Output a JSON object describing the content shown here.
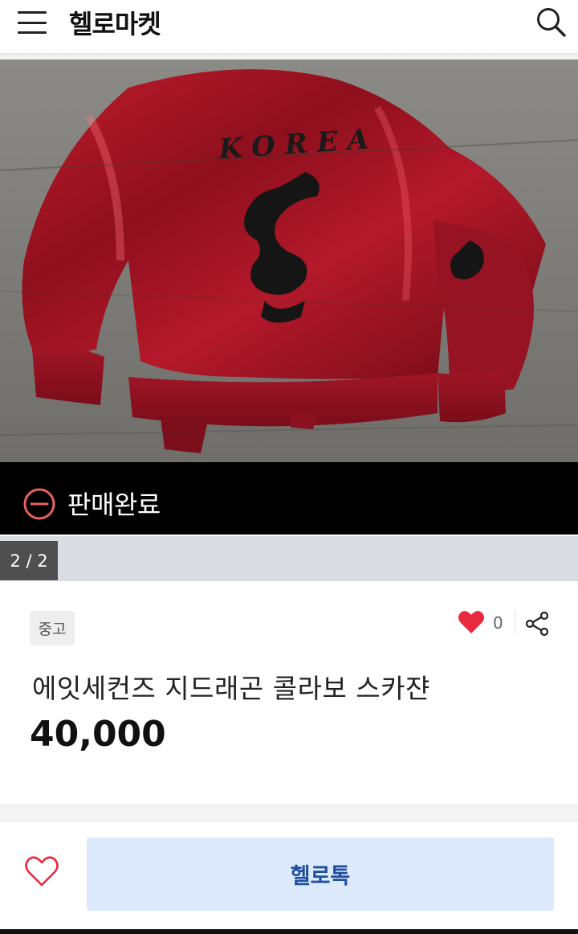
{
  "header": {
    "menu_icon": "hamburger-menu-icon",
    "title": "헬로마켓",
    "search_icon": "search-icon"
  },
  "photo": {
    "embroidered_text": "KOREA",
    "description_icon": "product-photo"
  },
  "status": {
    "label": "판매완료",
    "icon": "minus-circle-icon",
    "accent_color": "#e8615c"
  },
  "pager": {
    "label": "2 / 2"
  },
  "product": {
    "condition": "중고",
    "like_count": "0",
    "title": "에잇세컨즈 지드래곤 콜라보 스카쟌",
    "price": "40,000",
    "heart_color": "#e8293e"
  },
  "bottom_bar": {
    "wish_icon": "heart-outline-icon",
    "chat_label": "헬로톡",
    "chat_color": "#ddeafb"
  }
}
